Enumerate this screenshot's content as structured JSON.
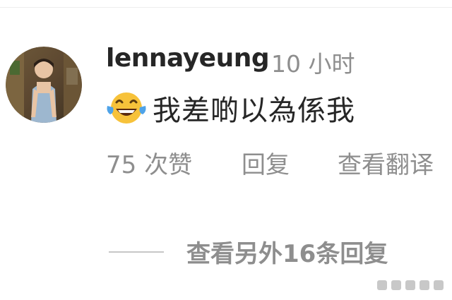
{
  "comment": {
    "username": "lennayeung",
    "timestamp": "10 小时",
    "emoji": "face-with-tears-of-joy-icon",
    "text": "我差啲以為係我",
    "likes": "75 次赞",
    "reply_label": "回复",
    "translate_label": "查看翻译"
  },
  "replies": {
    "view_more_label": "查看另外16条回复"
  },
  "colors": {
    "text_primary": "#262626",
    "text_secondary": "#8e8e8e",
    "divider": "#c7c7c7",
    "emoji_yellow": "#f7c23a",
    "tear_blue": "#4fa3e8"
  }
}
